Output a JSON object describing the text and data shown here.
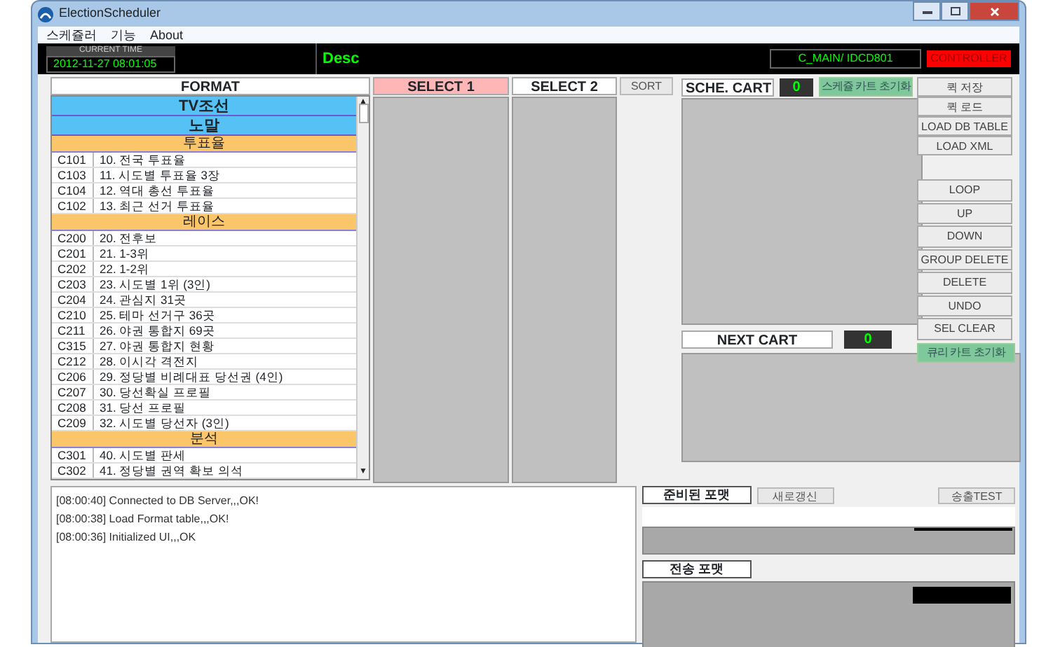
{
  "window": {
    "title": "ElectionScheduler"
  },
  "menu": [
    "스케쥴러",
    "기능",
    "About"
  ],
  "status": {
    "time_label": "CURRENT TIME",
    "time": "2012-11-27 08:01:05",
    "desc": "Desc",
    "main_id": "C_MAIN/ IDCD801",
    "controller": "CONTROLLER"
  },
  "format": {
    "header": "FORMAT",
    "items": [
      {
        "kind": "channel",
        "label": "TV조선"
      },
      {
        "kind": "channel",
        "label": "노말"
      },
      {
        "kind": "section",
        "label": "투표율"
      },
      {
        "kind": "item",
        "code": "C101",
        "label": "10. 전국 투표율"
      },
      {
        "kind": "item",
        "code": "C103",
        "label": "11. 시도별 투표율 3장"
      },
      {
        "kind": "item",
        "code": "C104",
        "label": "12. 역대 총선 투표율"
      },
      {
        "kind": "item",
        "code": "C102",
        "label": "13. 최근 선거 투표율"
      },
      {
        "kind": "section",
        "label": "레이스"
      },
      {
        "kind": "item",
        "code": "C200",
        "label": "20. 전후보"
      },
      {
        "kind": "item",
        "code": "C201",
        "label": "21. 1-3위"
      },
      {
        "kind": "item",
        "code": "C202",
        "label": "22. 1-2위"
      },
      {
        "kind": "item",
        "code": "C203",
        "label": "23. 시도별 1위 (3인)"
      },
      {
        "kind": "item",
        "code": "C204",
        "label": "24. 관심지 31곳"
      },
      {
        "kind": "item",
        "code": "C210",
        "label": "25. 테마 선거구 36곳"
      },
      {
        "kind": "item",
        "code": "C211",
        "label": "26. 야권 통합지 69곳"
      },
      {
        "kind": "item",
        "code": "C315",
        "label": "27. 야권 통합지 현황"
      },
      {
        "kind": "item",
        "code": "C212",
        "label": "28. 이시각 격전지"
      },
      {
        "kind": "item",
        "code": "C206",
        "label": "29. 정당별 비례대표 당선권 (4인)"
      },
      {
        "kind": "item",
        "code": "C207",
        "label": "30. 당선확실 프로필"
      },
      {
        "kind": "item",
        "code": "C208",
        "label": "31. 당선 프로필"
      },
      {
        "kind": "item",
        "code": "C209",
        "label": "32. 시도별 당선자 (3인)"
      },
      {
        "kind": "section",
        "label": "분석"
      },
      {
        "kind": "item",
        "code": "C301",
        "label": "40. 시도별 판세"
      },
      {
        "kind": "item",
        "code": "C302",
        "label": "41. 정당별 권역 확보 의석"
      }
    ]
  },
  "format_scrollbar": {
    "up_arrow": "▲",
    "down_arrow": "▼"
  },
  "select1": {
    "header": "SELECT 1"
  },
  "select2": {
    "header": "SELECT 2",
    "sort_button": "SORT"
  },
  "sche_cart": {
    "title": "SCHE. CART",
    "count": "0",
    "reset_button": "스케쥴 카트 초기화"
  },
  "side_buttons": [
    {
      "kind": "top",
      "label": "퀵 저장"
    },
    {
      "kind": "top",
      "label": "퀵 로드"
    },
    {
      "kind": "top",
      "label": "LOAD DB TABLE"
    },
    {
      "kind": "top",
      "label": "LOAD XML"
    },
    {
      "kind": "lower",
      "label": "LOOP"
    },
    {
      "kind": "lower",
      "label": "UP"
    },
    {
      "kind": "lower",
      "label": "DOWN"
    },
    {
      "kind": "lower",
      "label": "GROUP DELETE"
    },
    {
      "kind": "lower",
      "label": "DELETE"
    },
    {
      "kind": "lower",
      "label": "UNDO"
    },
    {
      "kind": "lower",
      "label": "SEL CLEAR"
    }
  ],
  "next_cart": {
    "title": "NEXT CART",
    "count": "0",
    "reset_button": "큐리 카트 초기화"
  },
  "log": [
    "[08:00:40] Connected to DB Server,,,OK!",
    "[08:00:38] Load Format table,,,OK!",
    "[08:00:36] Initialized UI,,,OK"
  ],
  "ready_format": {
    "title": "준비된 포맷",
    "refresh_button": "새로갱신",
    "test_button": "송출TEST"
  },
  "send_format": {
    "title": "전송 포맷"
  }
}
